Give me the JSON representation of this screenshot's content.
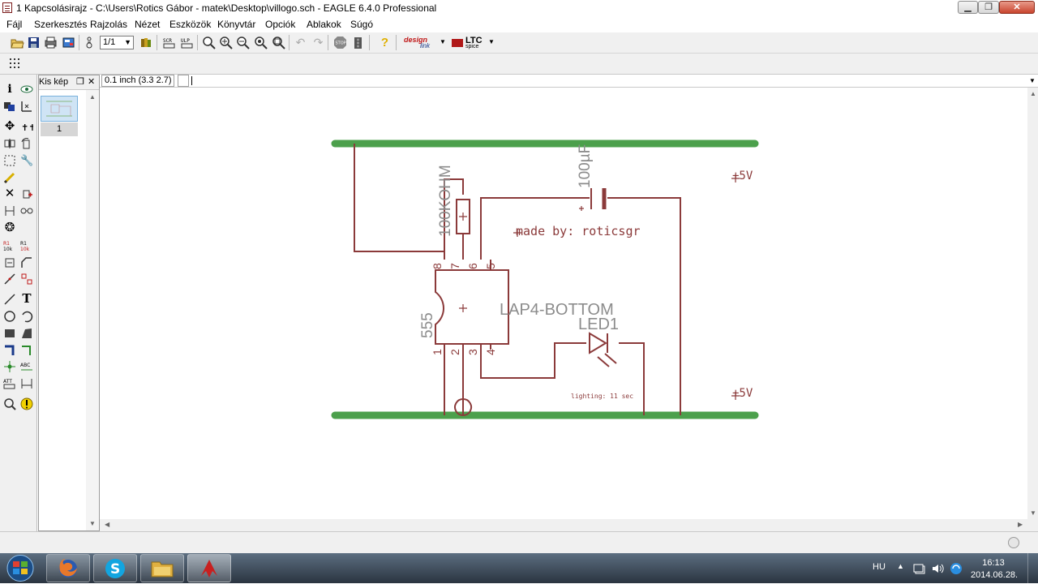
{
  "window": {
    "title": "1 Kapcsolásirajz - C:\\Users\\Rotics Gábor - matek\\Desktop\\villogo.sch - EAGLE 6.4.0 Professional"
  },
  "menu": [
    "Fájl",
    "Szerkesztés",
    "Rajzolás",
    "Nézet",
    "Eszközök",
    "Könyvtár",
    "Opciók",
    "Ablakok",
    "Súgó"
  ],
  "toolbar": {
    "sheet_select": "1/1",
    "designlink_top": "design",
    "designlink_bottom": "link",
    "ltc_top": "LTC",
    "ltc_bottom": "spice"
  },
  "thumbnail_panel": {
    "title": "Kis kép",
    "sheet_number": "1"
  },
  "coordbar": {
    "readout": "0.1 inch (3.3 2.7)"
  },
  "schematic": {
    "resistor_value": "100KOHM",
    "capacitor_value": "100µF",
    "ic_value": "555",
    "ic_name": "LAP4-BOTTOM",
    "led_name": "LED1",
    "credit": "made by: roticsgr",
    "note": "lighting: 11 sec",
    "supply_top": "+5V",
    "supply_bottom": "+5V",
    "pins": [
      "8",
      "7",
      "6",
      "5",
      "1",
      "2",
      "3",
      "4"
    ],
    "colors": {
      "wire": "#8b3a3a",
      "bus": "#4ca04c",
      "text": "#8c8c8c"
    }
  },
  "taskbar": {
    "lang": "HU",
    "time": "16:13",
    "date": "2014.06.28."
  }
}
